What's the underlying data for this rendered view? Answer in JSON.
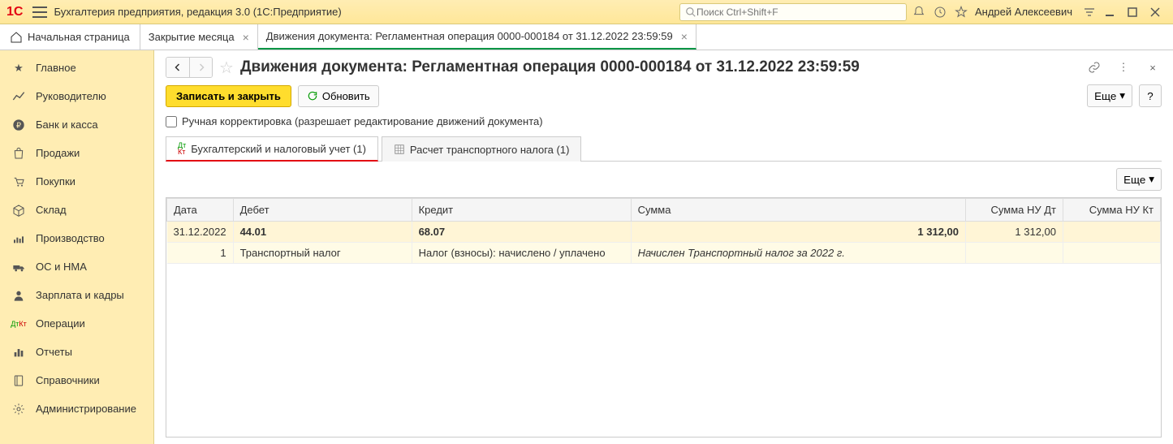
{
  "titlebar": {
    "app_title": "Бухгалтерия предприятия, редакция 3.0  (1С:Предприятие)",
    "search_placeholder": "Поиск Ctrl+Shift+F",
    "user": "Андрей Алексеевич"
  },
  "tabs": {
    "home": "Начальная страница",
    "tab1": "Закрытие месяца",
    "tab2": "Движения документа: Регламентная операция 0000-000184 от 31.12.2022 23:59:59"
  },
  "sidebar": {
    "items": [
      "Главное",
      "Руководителю",
      "Банк и касса",
      "Продажи",
      "Покупки",
      "Склад",
      "Производство",
      "ОС и НМА",
      "Зарплата и кадры",
      "Операции",
      "Отчеты",
      "Справочники",
      "Администрирование"
    ]
  },
  "content": {
    "title": "Движения документа: Регламентная операция 0000-000184 от 31.12.2022 23:59:59",
    "save_close": "Записать и закрыть",
    "refresh": "Обновить",
    "more": "Еще",
    "help": "?",
    "manual_edit": "Ручная корректировка (разрешает редактирование движений документа)",
    "inner_tabs": {
      "accounting": "Бухгалтерский и налоговый учет (1)",
      "transport": "Расчет транспортного налога (1)"
    },
    "table": {
      "headers": {
        "date": "Дата",
        "debit": "Дебет",
        "credit": "Кредит",
        "sum": "Сумма",
        "sum_nu_dt": "Сумма НУ Дт",
        "sum_nu_kt": "Сумма НУ Кт"
      },
      "row1": {
        "date": "31.12.2022",
        "debit": "44.01",
        "credit": "68.07",
        "sum": "1 312,00",
        "sum_nu_dt": "1 312,00"
      },
      "row2": {
        "n": "1",
        "debit_text": "Транспортный налог",
        "credit_text": "Налог (взносы): начислено / уплачено",
        "sum_text": "Начислен Транспортный налог за 2022 г."
      }
    }
  }
}
